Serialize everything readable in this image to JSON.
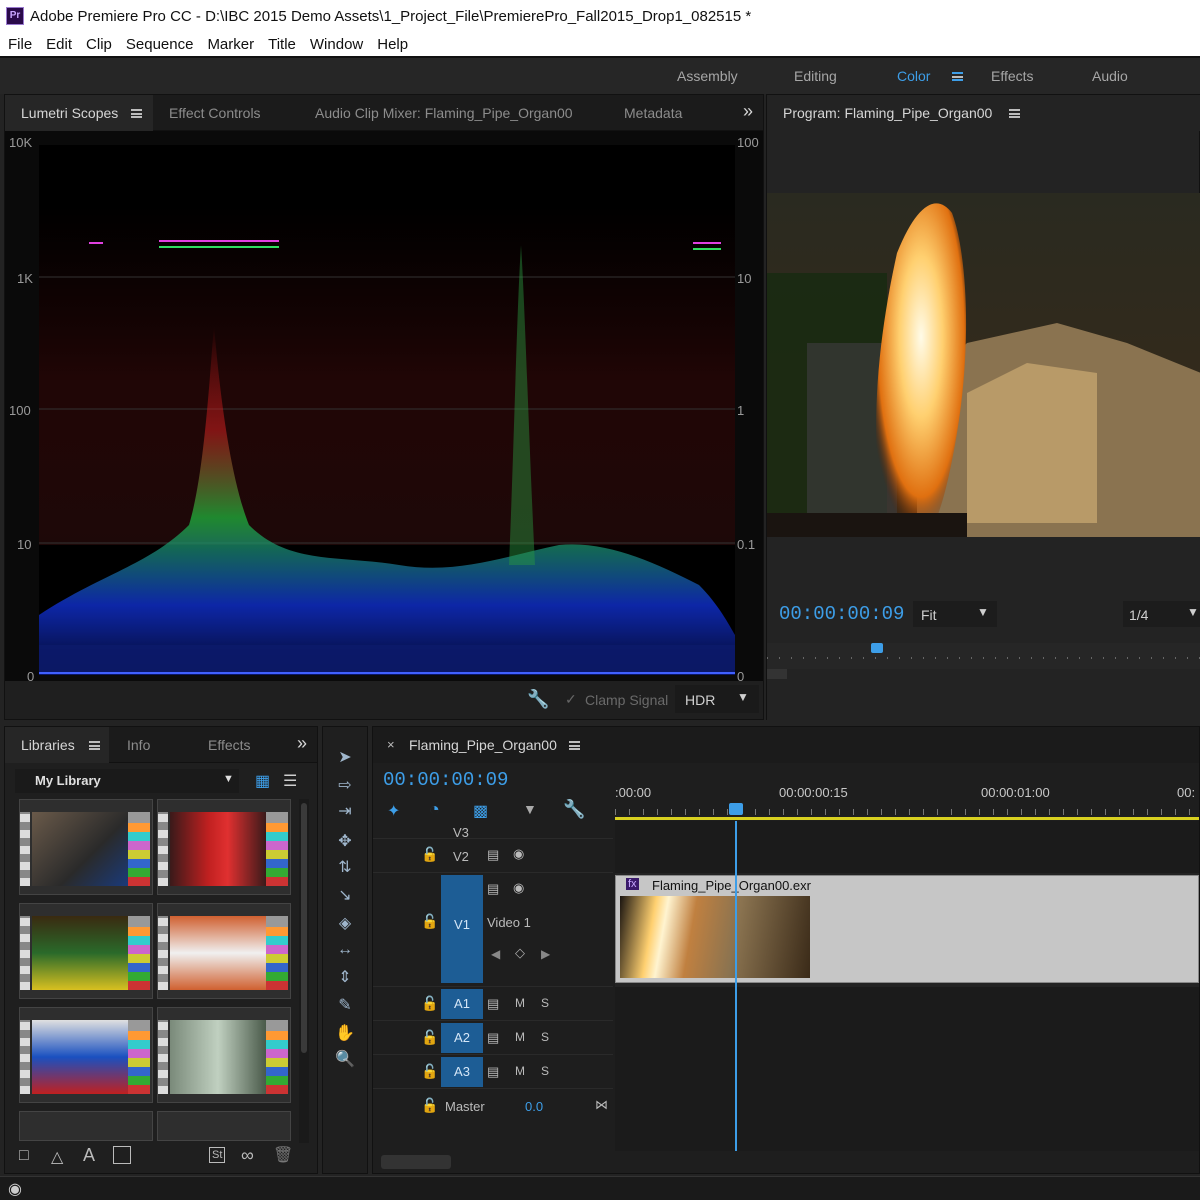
{
  "app": {
    "title": "Adobe Premiere Pro CC - D:\\IBC 2015 Demo Assets\\1_Project_File\\PremierePro_Fall2015_Drop1_082515 *",
    "icon_label": "Pr"
  },
  "menu": [
    "File",
    "Edit",
    "Clip",
    "Sequence",
    "Marker",
    "Title",
    "Window",
    "Help"
  ],
  "workspaces": [
    {
      "label": "Assembly",
      "active": false
    },
    {
      "label": "Editing",
      "active": false
    },
    {
      "label": "Color",
      "active": true
    },
    {
      "label": "Effects",
      "active": false
    },
    {
      "label": "Audio",
      "active": false
    }
  ],
  "source_panel": {
    "tabs": [
      "Lumetri Scopes",
      "Effect Controls",
      "Audio Clip Mixer: Flaming_Pipe_Organ00",
      "Metadata"
    ],
    "more_glyph": "»",
    "scope": {
      "left_axis": [
        "10K",
        "1K",
        "100",
        "10",
        "0"
      ],
      "right_axis": [
        "100",
        "10",
        "1",
        "0.1",
        "0"
      ]
    },
    "footer": {
      "clamp_signal": "Clamp Signal",
      "mode": "HDR"
    }
  },
  "program": {
    "title": "Program: Flaming_Pipe_Organ00",
    "timecode": "00:00:00:09",
    "zoom": "Fit",
    "resolution": "1/4"
  },
  "libraries": {
    "tabs": [
      "Libraries",
      "Info",
      "Effects"
    ],
    "more_glyph": "»",
    "library_name": "My Library",
    "footer_icons": [
      "St"
    ]
  },
  "timeline": {
    "sequence_name": "Flaming_Pipe_Organ00",
    "timecode": "00:00:00:09",
    "ruler": [
      ":00:00",
      "00:00:00:15",
      "00:00:01:00",
      "00:"
    ],
    "tracks": {
      "v3": "V3",
      "v2": "V2",
      "v1": "V1",
      "v1_name": "Video 1",
      "a1": "A1",
      "a2": "A2",
      "a3": "A3",
      "mute": "M",
      "solo": "S",
      "master_label": "Master",
      "master_value": "0.0"
    },
    "clip": {
      "name": "Flaming_Pipe_Organ00.exr",
      "fx_badge": "fx"
    }
  }
}
